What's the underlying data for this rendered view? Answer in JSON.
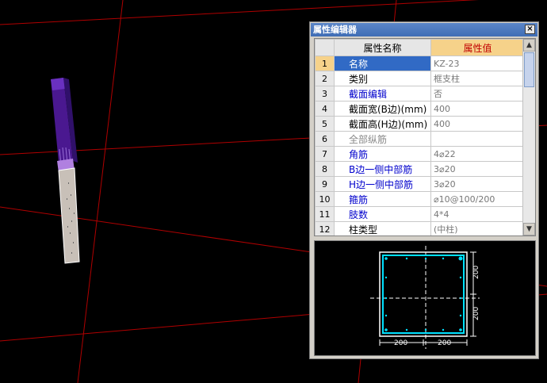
{
  "panel": {
    "title": "属性编辑器",
    "close_glyph": "×",
    "header": {
      "name": "属性名称",
      "value": "属性值"
    },
    "rows": [
      {
        "idx": "1",
        "name": "名称",
        "value": "KZ-23"
      },
      {
        "idx": "2",
        "name": "类别",
        "value": "框支柱"
      },
      {
        "idx": "3",
        "name": "截面编辑",
        "value": "否"
      },
      {
        "idx": "4",
        "name": "截面宽(B边)(mm)",
        "value": "400"
      },
      {
        "idx": "5",
        "name": "截面高(H边)(mm)",
        "value": "400"
      },
      {
        "idx": "6",
        "name": "全部纵筋",
        "value": ""
      },
      {
        "idx": "7",
        "name": "角筋",
        "value": "4⌀22"
      },
      {
        "idx": "8",
        "name": "B边一侧中部筋",
        "value": "3⌀20"
      },
      {
        "idx": "9",
        "name": "H边一侧中部筋",
        "value": "3⌀20"
      },
      {
        "idx": "10",
        "name": "箍筋",
        "value": "⌀10@100/200"
      },
      {
        "idx": "11",
        "name": "肢数",
        "value": "4*4"
      },
      {
        "idx": "12",
        "name": "柱类型",
        "value": "(中柱)"
      }
    ]
  },
  "preview": {
    "dim_right_top": "200",
    "dim_right_bottom": "200",
    "dim_bottom_left": "200",
    "dim_bottom_right": "200"
  },
  "colors": {
    "grid_line": "#b00000",
    "column_top": "#5a1fa8",
    "column_body": "#c8c0b8",
    "rebar": "#00e0ff"
  }
}
